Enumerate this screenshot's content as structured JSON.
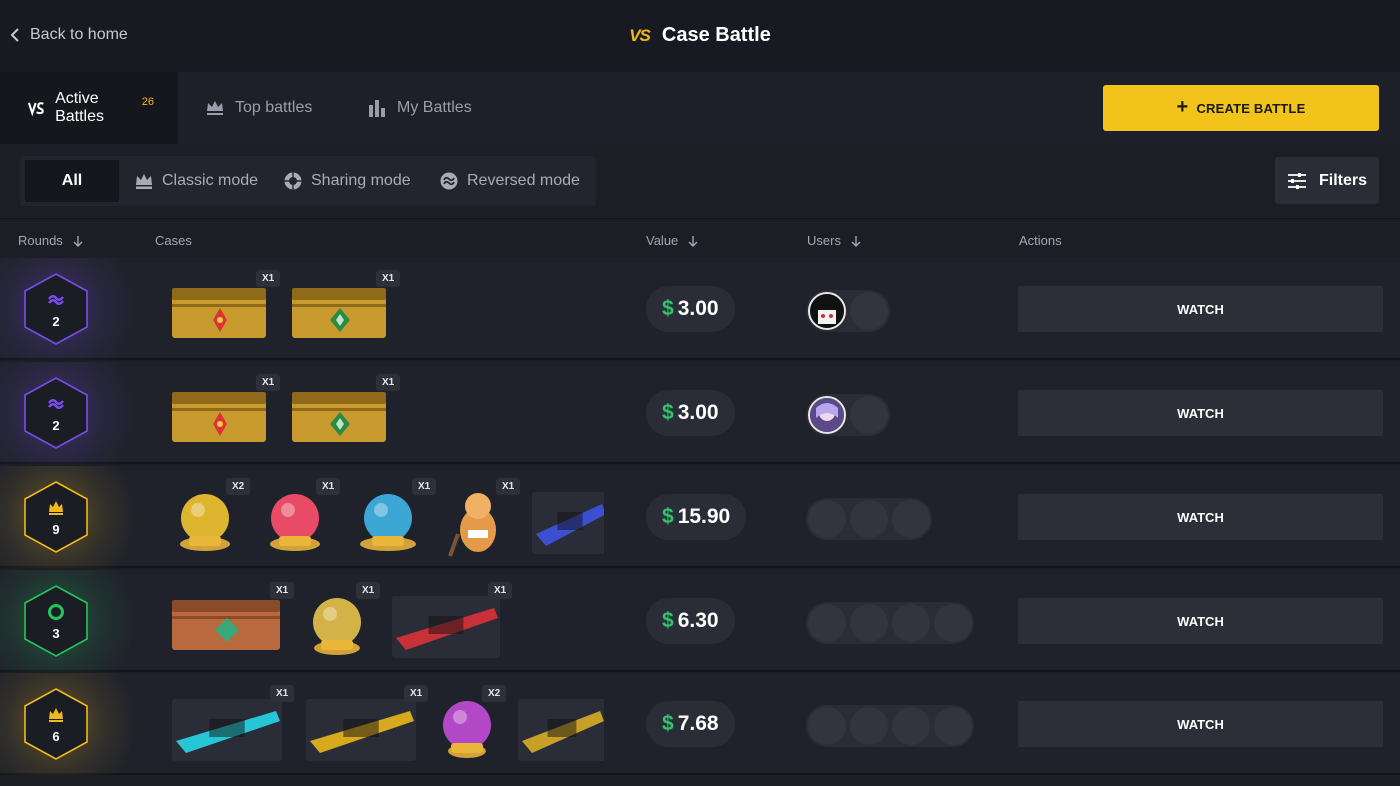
{
  "header": {
    "back_label": "Back to home",
    "title_vs": "VS",
    "title": "Case Battle"
  },
  "tabs": [
    {
      "label": "Active Battles",
      "count": "26",
      "active": true
    },
    {
      "label": "Top battles"
    },
    {
      "label": "My Battles"
    }
  ],
  "create_label": "CREATE BATTLE",
  "modes": [
    {
      "label": "All",
      "active": true
    },
    {
      "label": "Classic mode"
    },
    {
      "label": "Sharing mode"
    },
    {
      "label": "Reversed mode"
    }
  ],
  "filters_label": "Filters",
  "table": {
    "columns": {
      "rounds": "Rounds",
      "cases": "Cases",
      "value": "Value",
      "users": "Users",
      "actions": "Actions"
    },
    "watch_label": "WATCH",
    "rows": [
      {
        "mode": "reversed",
        "rounds": "2",
        "currency": "$",
        "value": "3.00",
        "user_slots": 2,
        "filled": 1,
        "avatar": "avatar-a",
        "cases": [
          {
            "kind": "crate-phoenix",
            "qty": "X1"
          },
          {
            "kind": "crate-breakout",
            "qty": "X1"
          }
        ]
      },
      {
        "mode": "reversed",
        "rounds": "2",
        "currency": "$",
        "value": "3.00",
        "user_slots": 2,
        "filled": 1,
        "avatar": "avatar-b",
        "cases": [
          {
            "kind": "crate-phoenix",
            "qty": "X1"
          },
          {
            "kind": "crate-breakout",
            "qty": "X1"
          }
        ]
      },
      {
        "mode": "classic",
        "rounds": "9",
        "currency": "$",
        "value": "15.90",
        "user_slots": 3,
        "filled": 0,
        "cases": [
          {
            "kind": "orb-skull",
            "qty": "X2"
          },
          {
            "kind": "orb-lambda",
            "qty": "X1"
          },
          {
            "kind": "orb-wings",
            "qty": "X1"
          },
          {
            "kind": "figure-cat",
            "qty": "X1"
          },
          {
            "kind": "weapon-blue",
            "qty": ""
          }
        ]
      },
      {
        "mode": "sharing",
        "rounds": "3",
        "currency": "$",
        "value": "6.30",
        "user_slots": 4,
        "filled": 0,
        "cases": [
          {
            "kind": "crate-wood",
            "qty": "X1"
          },
          {
            "kind": "orb-gold",
            "qty": "X1"
          },
          {
            "kind": "weapon-red",
            "qty": "X1"
          }
        ]
      },
      {
        "mode": "classic",
        "rounds": "6",
        "currency": "$",
        "value": "7.68",
        "user_slots": 4,
        "filled": 0,
        "cases": [
          {
            "kind": "weapon-cyan",
            "qty": "X1"
          },
          {
            "kind": "weapon-gold",
            "qty": "X1"
          },
          {
            "kind": "orb-purple",
            "qty": "X2"
          },
          {
            "kind": "weapon-yellow",
            "qty": ""
          }
        ]
      }
    ]
  },
  "colors": {
    "accent": "#f1c31b",
    "money": "#2ec56c",
    "reversed": "#7b4df0",
    "classic": "#f1b91b",
    "sharing": "#22c55e"
  }
}
